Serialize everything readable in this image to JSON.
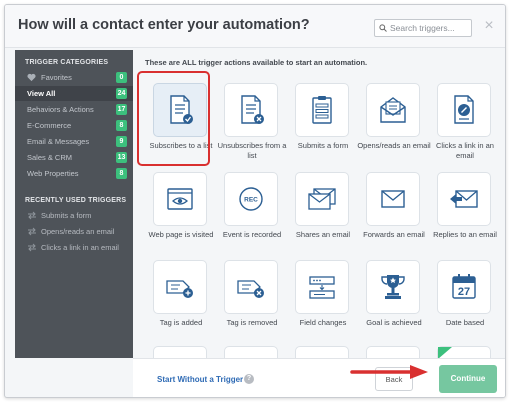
{
  "header": {
    "title": "How will a contact enter your automation?",
    "search_placeholder": "Search triggers...",
    "close_label": "×"
  },
  "sidebar": {
    "categories_heading": "TRIGGER CATEGORIES",
    "categories": [
      {
        "label": "Favorites",
        "count": "0",
        "icon": "heart-icon"
      },
      {
        "label": "View All",
        "count": "24",
        "active": true
      },
      {
        "label": "Behaviors & Actions",
        "count": "17"
      },
      {
        "label": "E-Commerce",
        "count": "8"
      },
      {
        "label": "Email & Messages",
        "count": "9"
      },
      {
        "label": "Sales & CRM",
        "count": "13"
      },
      {
        "label": "Web Properties",
        "count": "8"
      }
    ],
    "recent_heading": "RECENTLY USED TRIGGERS",
    "recent": [
      {
        "label": "Submits a form"
      },
      {
        "label": "Opens/reads an email"
      },
      {
        "label": "Clicks a link in an email"
      }
    ]
  },
  "content": {
    "intro": "These are ALL trigger actions available to start an automation.",
    "triggers": [
      {
        "label": "Subscribes to a list",
        "icon": "subscribe-list-icon",
        "selected": true
      },
      {
        "label": "Unsubscribes from a list",
        "icon": "unsubscribe-list-icon"
      },
      {
        "label": "Submits a form",
        "icon": "form-icon"
      },
      {
        "label": "Opens/reads an email",
        "icon": "open-email-icon"
      },
      {
        "label": "Clicks a link in an email",
        "icon": "link-email-icon"
      },
      {
        "label": "Web page is visited",
        "icon": "web-page-icon"
      },
      {
        "label": "Event is recorded",
        "icon": "rec-icon",
        "badge": "REC"
      },
      {
        "label": "Shares an email",
        "icon": "share-email-icon"
      },
      {
        "label": "Forwards an email",
        "icon": "forward-email-icon"
      },
      {
        "label": "Replies to an email",
        "icon": "reply-email-icon"
      },
      {
        "label": "Tag is added",
        "icon": "tag-add-icon"
      },
      {
        "label": "Tag is removed",
        "icon": "tag-remove-icon"
      },
      {
        "label": "Field changes",
        "icon": "field-changes-icon"
      },
      {
        "label": "Goal is achieved",
        "icon": "trophy-icon"
      },
      {
        "label": "Date based",
        "icon": "calendar-icon",
        "date": "27"
      }
    ]
  },
  "footer": {
    "start_without": "Start Without a Trigger",
    "help": "?",
    "back": "Back",
    "continue": "Continue"
  },
  "colors": {
    "accent_green": "#3cc07d",
    "continue_green": "#76c7a0",
    "link_blue": "#2f6bb5",
    "icon_blue": "#2c5f93",
    "highlight_red": "#d93030",
    "sidebar_bg": "#4e5359"
  }
}
